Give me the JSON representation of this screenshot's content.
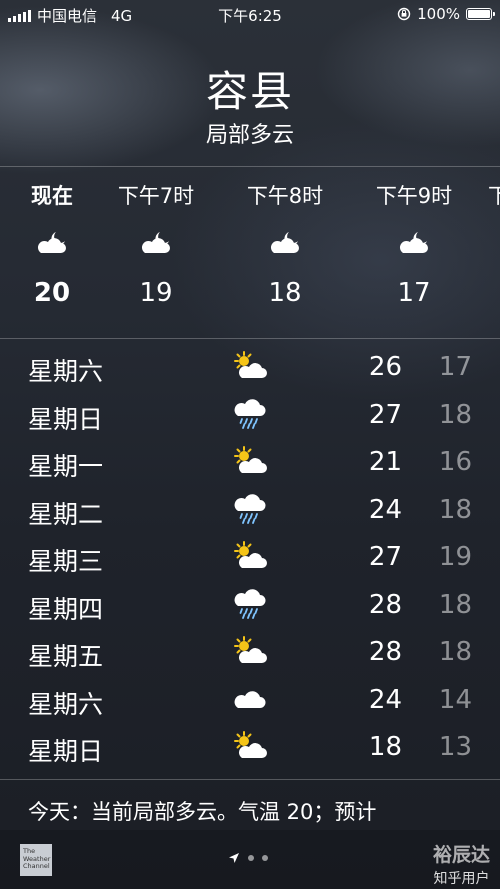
{
  "status_bar": {
    "carrier": "中国电信",
    "network": "4G",
    "time": "下午6:25",
    "battery": "100%",
    "battery_level": 1.0
  },
  "location": {
    "city": "容县",
    "condition": "局部多云"
  },
  "hourly": [
    {
      "label": "现在",
      "icon": "partly-cloudy-night-icon",
      "temp": "20"
    },
    {
      "label": "下午7时",
      "icon": "partly-cloudy-night-icon",
      "temp": "19"
    },
    {
      "label": "下午8时",
      "icon": "partly-cloudy-night-icon",
      "temp": "18"
    },
    {
      "label": "下午9时",
      "icon": "partly-cloudy-night-icon",
      "temp": "17"
    },
    {
      "label": "下",
      "icon": "partly-cloudy-night-icon",
      "temp": ""
    }
  ],
  "daily": [
    {
      "day": "星期六",
      "icon": "partly-sunny-icon",
      "high": "26",
      "low": "17"
    },
    {
      "day": "星期日",
      "icon": "rain-icon",
      "high": "27",
      "low": "18"
    },
    {
      "day": "星期一",
      "icon": "partly-sunny-icon",
      "high": "21",
      "low": "16"
    },
    {
      "day": "星期二",
      "icon": "rain-icon",
      "high": "24",
      "low": "18"
    },
    {
      "day": "星期三",
      "icon": "partly-sunny-icon",
      "high": "27",
      "low": "19"
    },
    {
      "day": "星期四",
      "icon": "rain-icon",
      "high": "28",
      "low": "18"
    },
    {
      "day": "星期五",
      "icon": "partly-sunny-icon",
      "high": "28",
      "low": "18"
    },
    {
      "day": "星期六",
      "icon": "cloud-icon",
      "high": "24",
      "low": "14"
    },
    {
      "day": "星期日",
      "icon": "partly-sunny-icon",
      "high": "18",
      "low": "13"
    }
  ],
  "summary": "今天：当前局部多云。气温 20；预计",
  "footer": {
    "provider_logo": "The Weather Channel",
    "watermark_title": "裕辰达",
    "watermark_sub": "知乎用户"
  },
  "colors": {
    "sun": "#f5c518",
    "cloud": "#ffffff",
    "rain": "#7fc4ff",
    "low_temp": "rgba(255,255,255,0.5)"
  }
}
